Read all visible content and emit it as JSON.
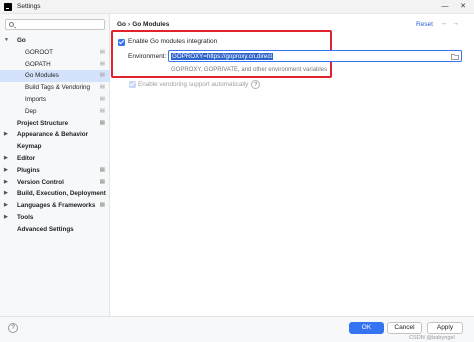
{
  "window": {
    "title": "Settings",
    "min_glyph": "—",
    "close_glyph": "✕"
  },
  "sidebar": {
    "search_placeholder": "",
    "items": [
      {
        "label": "Go",
        "expanded": true,
        "bold": true,
        "indent": 0,
        "gear": false,
        "selected": false
      },
      {
        "label": "GOROOT",
        "indent": 1,
        "gear": true,
        "selected": false
      },
      {
        "label": "GOPATH",
        "indent": 1,
        "gear": true,
        "selected": false
      },
      {
        "label": "Go Modules",
        "indent": 1,
        "gear": true,
        "selected": true
      },
      {
        "label": "Build Tags & Vendoring",
        "indent": 1,
        "gear": true,
        "selected": false
      },
      {
        "label": "Imports",
        "indent": 1,
        "gear": true,
        "selected": false
      },
      {
        "label": "Dep",
        "indent": 1,
        "gear": true,
        "selected": false
      },
      {
        "label": "Project Structure",
        "bold": true,
        "indent": 0,
        "gear": true,
        "selected": false
      },
      {
        "label": "Appearance & Behavior",
        "expanded": false,
        "bold": true,
        "indent": 0,
        "gear": false,
        "selected": false
      },
      {
        "label": "Keymap",
        "bold": true,
        "indent": 0,
        "gear": false,
        "selected": false
      },
      {
        "label": "Editor",
        "expanded": false,
        "bold": true,
        "indent": 0,
        "gear": false,
        "selected": false
      },
      {
        "label": "Plugins",
        "expanded": false,
        "bold": true,
        "indent": 0,
        "gear": true,
        "selected": false
      },
      {
        "label": "Version Control",
        "expanded": false,
        "bold": true,
        "indent": 0,
        "gear": true,
        "selected": false
      },
      {
        "label": "Build, Execution, Deployment",
        "expanded": false,
        "bold": true,
        "indent": 0,
        "gear": false,
        "selected": false
      },
      {
        "label": "Languages & Frameworks",
        "expanded": false,
        "bold": true,
        "indent": 0,
        "gear": true,
        "selected": false
      },
      {
        "label": "Tools",
        "expanded": false,
        "bold": true,
        "indent": 0,
        "gear": false,
        "selected": false
      },
      {
        "label": "Advanced Settings",
        "bold": true,
        "indent": 0,
        "gear": false,
        "selected": false
      }
    ]
  },
  "main": {
    "breadcrumb": [
      "Go",
      "Go Modules"
    ],
    "breadcrumb_separator": "›",
    "reset_label": "Reset",
    "nav_back": "←",
    "nav_forward": "→",
    "enable_modules": {
      "label": "Enable Go modules integration",
      "checked": true
    },
    "environment": {
      "label": "Environment:",
      "value": "GOPROXY=https://goproxy.cn,direct",
      "hint": "GOPROXY, GOPRIVATE, and other environment variables"
    },
    "vendoring": {
      "label": "Enable vendoring support automatically",
      "checked": true,
      "disabled": true,
      "help": "?"
    }
  },
  "footer": {
    "help": "?",
    "ok": "OK",
    "cancel": "Cancel",
    "apply": "Apply",
    "watermark": "CSDN @babyngel"
  },
  "colors": {
    "accent": "#3574f0",
    "highlight_box": "#e0242f",
    "selection": "#d4e2fb",
    "link": "#2a5fd4"
  }
}
